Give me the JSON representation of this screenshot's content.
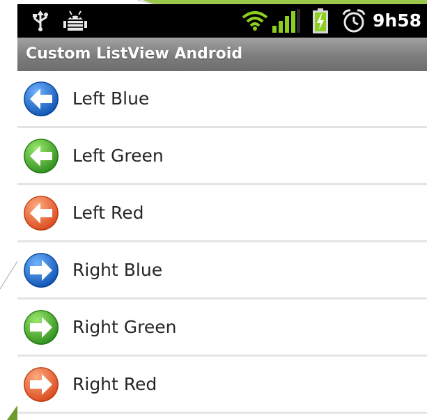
{
  "app": {
    "title": "Custom ListView Android"
  },
  "status_bar": {
    "time": "9h58",
    "icons": [
      "usb-icon",
      "android-debug-icon",
      "wifi-icon",
      "signal-icon",
      "battery-charging-icon",
      "alarm-icon"
    ]
  },
  "list": {
    "items": [
      {
        "label": "Left Blue",
        "icon": "arrow-left-blue-icon",
        "color": "#1a66cc",
        "direction": "left"
      },
      {
        "label": "Left Green",
        "icon": "arrow-left-green-icon",
        "color": "#3aa62a",
        "direction": "left"
      },
      {
        "label": "Left Red",
        "icon": "arrow-left-red-icon",
        "color": "#ec5b2c",
        "direction": "left"
      },
      {
        "label": "Right Blue",
        "icon": "arrow-right-blue-icon",
        "color": "#1a66cc",
        "direction": "right"
      },
      {
        "label": "Right Green",
        "icon": "arrow-right-green-icon",
        "color": "#3aa62a",
        "direction": "right"
      },
      {
        "label": "Right Red",
        "icon": "arrow-right-red-icon",
        "color": "#ec5b2c",
        "direction": "right"
      }
    ]
  },
  "colors": {
    "status_bar_bg": "#000000",
    "title_bar_bg": "#7d7d7d",
    "wifi_green": "#8ccf1e",
    "divider": "#e4e4e4",
    "slide_accent": "#9bc74a"
  }
}
